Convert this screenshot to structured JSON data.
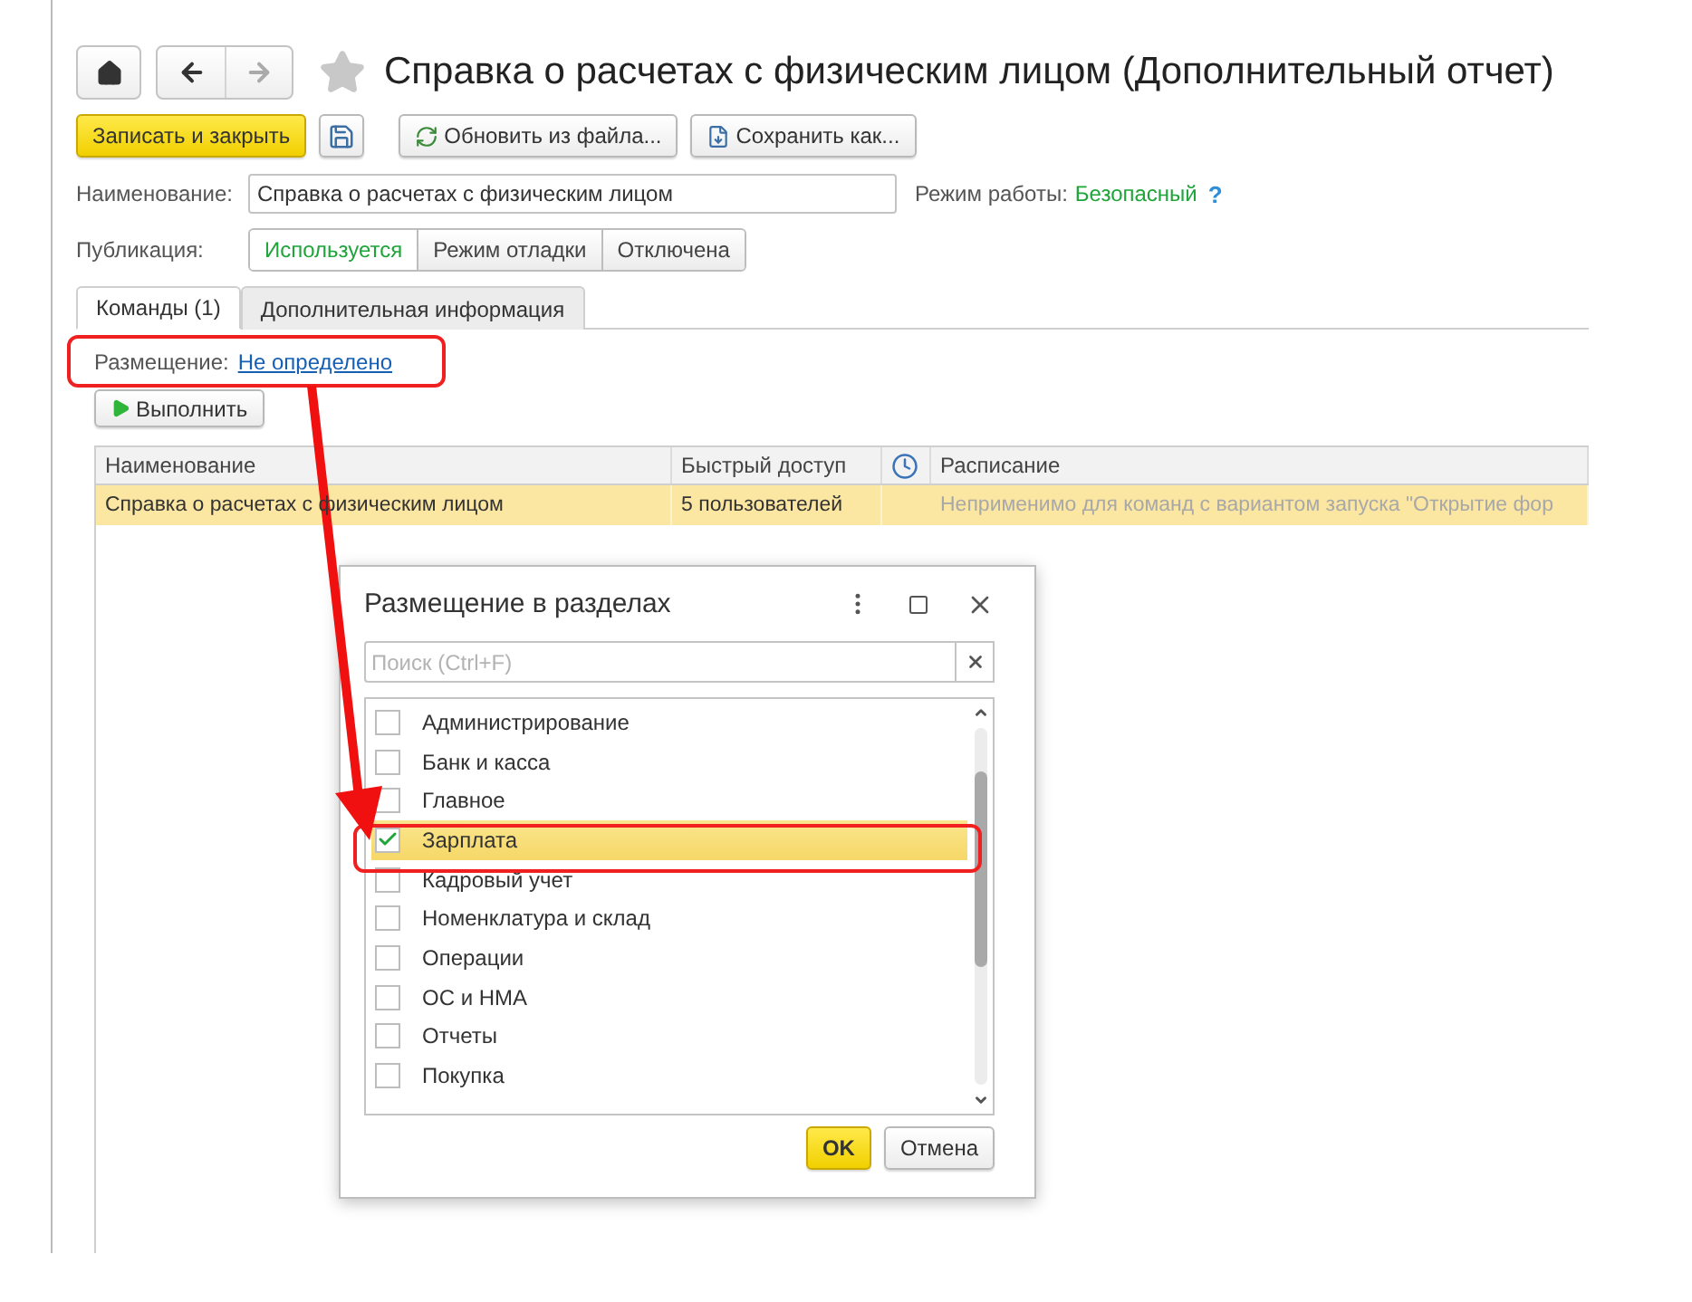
{
  "window": {
    "title": "Справка о расчетах с физическим лицом (Дополнительный отчет)"
  },
  "toolbar": [
    {
      "kind": "primary",
      "label": "Записать и закрыть"
    },
    {
      "kind": "save"
    },
    {
      "kind": "refresh",
      "label": "Обновить из файла..."
    },
    {
      "kind": "saveas",
      "label": "Сохранить как..."
    }
  ],
  "name_field": {
    "label": "Наименование:",
    "value": "Справка о расчетах с физическим лицом"
  },
  "mode": {
    "label": "Режим работы:",
    "value": "Безопасный",
    "help": "?"
  },
  "publication": {
    "label": "Публикация:",
    "options": [
      {
        "label": "Используется",
        "selected": true
      },
      {
        "label": "Режим отладки",
        "selected": false
      },
      {
        "label": "Отключена",
        "selected": false
      }
    ]
  },
  "tabs": [
    {
      "label": "Команды (1)",
      "selected": true
    },
    {
      "label": "Дополнительная информация",
      "selected": false
    }
  ],
  "placement": {
    "label": "Размещение:",
    "link": "Не определено"
  },
  "run_button": "Выполнить",
  "table": {
    "columns": [
      {
        "kind": "text",
        "label": "Наименование"
      },
      {
        "kind": "text",
        "label": "Быстрый доступ"
      },
      {
        "kind": "clock"
      },
      {
        "kind": "text",
        "label": "Расписание"
      }
    ],
    "rows": [
      {
        "selected": true,
        "name": "Справка о расчетах с физическим лицом",
        "quick_access": "5 пользователей",
        "schedule": "Неприменимо для команд с вариантом запуска \"Открытие фор"
      }
    ]
  },
  "dialog": {
    "title": "Размещение в разделах",
    "search": {
      "placeholder": "Поиск (Ctrl+F)"
    },
    "items": [
      {
        "label": "Администрирование",
        "checked": false,
        "selected": false
      },
      {
        "label": "Банк и касса",
        "checked": false,
        "selected": false
      },
      {
        "label": "Главное",
        "checked": false,
        "selected": false
      },
      {
        "label": "Зарплата",
        "checked": true,
        "selected": true
      },
      {
        "label": "Кадровый учет",
        "checked": false,
        "selected": false
      },
      {
        "label": "Номенклатура и склад",
        "checked": false,
        "selected": false
      },
      {
        "label": "Операции",
        "checked": false,
        "selected": false
      },
      {
        "label": "ОС и НМА",
        "checked": false,
        "selected": false
      },
      {
        "label": "Отчеты",
        "checked": false,
        "selected": false
      },
      {
        "label": "Покупка",
        "checked": false,
        "selected": false
      }
    ],
    "buttons": [
      {
        "kind": "default",
        "label": "OK"
      },
      {
        "kind": "normal",
        "label": "Отмена"
      }
    ]
  }
}
